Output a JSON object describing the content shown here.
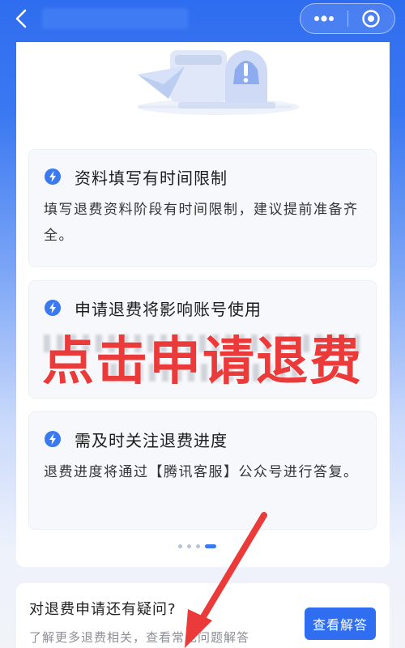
{
  "nav": {
    "back_icon": "chevron-left-icon",
    "more_icon": "more-dots-icon",
    "close_icon": "target-circle-icon"
  },
  "notices": [
    {
      "icon": "lightning-icon",
      "title": "资料填写有时间限制",
      "body": "填写退费资料阶段有时间限制，建议提前准备齐全。"
    },
    {
      "icon": "lightning-icon",
      "title": "申请退费将影响账号使用",
      "body": ""
    },
    {
      "icon": "lightning-icon",
      "title": "需及时关注退费进度",
      "body": "退费进度将通过【腾讯客服】公众号进行答复。"
    }
  ],
  "carousel": {
    "total": 4,
    "active": 4
  },
  "overlay": {
    "text": "点击申请退费",
    "color": "#ea3a3a"
  },
  "faq": {
    "title": "对退费申请还有疑问?",
    "subtitle": "了解更多退费相关，查看常见问题解答",
    "button_label": "查看解答"
  },
  "colors": {
    "primary": "#2f6ef0",
    "accent": "#ea3a3a"
  }
}
